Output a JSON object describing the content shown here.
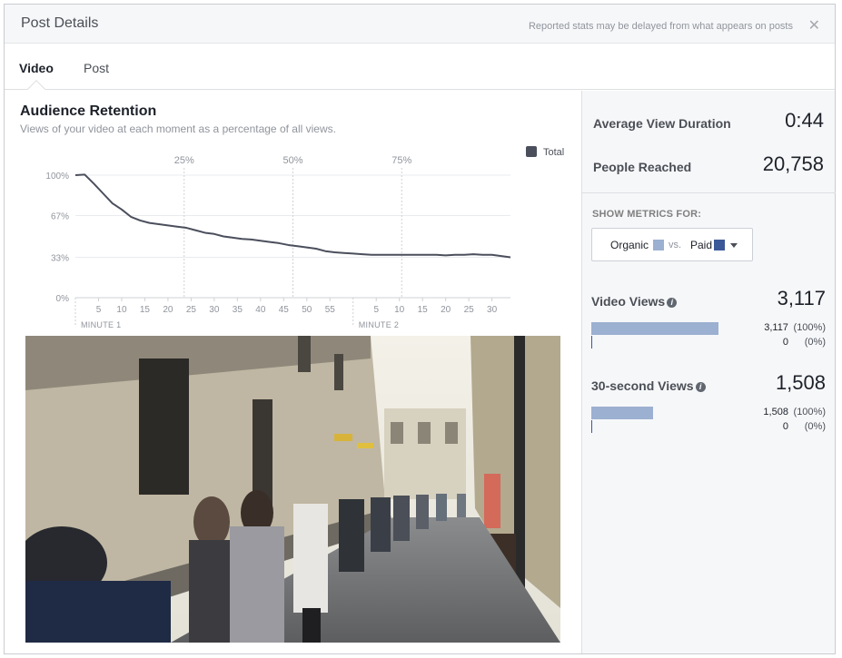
{
  "header": {
    "title": "Post Details",
    "note": "Reported stats may be delayed from what appears on posts",
    "close_glyph": "✕"
  },
  "tabs": [
    {
      "label": "Video",
      "active": true
    },
    {
      "label": "Post",
      "active": false
    }
  ],
  "retention": {
    "title": "Audience Retention",
    "subtitle": "Views of your video at each moment as a percentage of all views."
  },
  "chart_data": {
    "type": "line",
    "series": [
      {
        "name": "Total",
        "color": "#4b4f5c",
        "x": [
          0,
          2,
          4,
          6,
          8,
          10,
          12,
          14,
          16,
          18,
          20,
          22,
          24,
          26,
          28,
          30,
          32,
          34,
          36,
          38,
          40,
          42,
          44,
          46,
          48,
          50,
          52,
          54,
          56,
          58,
          60,
          62,
          64,
          66,
          68,
          70,
          72,
          74,
          76,
          78,
          80,
          82,
          84,
          86,
          88,
          90,
          92,
          94
        ],
        "values": [
          100,
          100.5,
          93,
          85,
          77,
          72,
          66,
          63,
          61,
          60,
          59,
          58,
          57,
          55,
          53,
          52,
          50,
          49,
          48,
          47.5,
          46.5,
          45.5,
          44.5,
          43,
          42,
          41,
          40,
          38,
          37,
          36.5,
          36,
          35.5,
          35,
          35,
          35,
          35,
          35,
          35,
          35,
          35,
          34.5,
          35,
          35,
          35.5,
          35,
          35,
          34,
          33
        ]
      }
    ],
    "y_ticks": [
      "100%",
      "67%",
      "33%",
      "0%"
    ],
    "y_tick_values": [
      100,
      67,
      33,
      0
    ],
    "ylim": [
      0,
      100
    ],
    "xlim": [
      0,
      94
    ],
    "quartiles": [
      {
        "label": "25%",
        "x": 23.5
      },
      {
        "label": "50%",
        "x": 47
      },
      {
        "label": "75%",
        "x": 70.5
      }
    ],
    "x_ticks": [
      {
        "x": 5,
        "label": "5"
      },
      {
        "x": 10,
        "label": "10"
      },
      {
        "x": 15,
        "label": "15"
      },
      {
        "x": 20,
        "label": "20"
      },
      {
        "x": 25,
        "label": "25"
      },
      {
        "x": 30,
        "label": "30"
      },
      {
        "x": 35,
        "label": "35"
      },
      {
        "x": 40,
        "label": "40"
      },
      {
        "x": 45,
        "label": "45"
      },
      {
        "x": 50,
        "label": "50"
      },
      {
        "x": 55,
        "label": "55"
      },
      {
        "x": 65,
        "label": "5"
      },
      {
        "x": 70,
        "label": "10"
      },
      {
        "x": 75,
        "label": "15"
      },
      {
        "x": 80,
        "label": "20"
      },
      {
        "x": 85,
        "label": "25"
      },
      {
        "x": 90,
        "label": "30"
      }
    ],
    "minute_markers": [
      {
        "x": 0,
        "label": "MINUTE 1"
      },
      {
        "x": 60,
        "label": "MINUTE 2"
      }
    ],
    "legend": {
      "label": "Total",
      "position": "top-right"
    },
    "grid": true
  },
  "stats": {
    "avg_view_label": "Average View Duration",
    "avg_view_value": "0:44",
    "reached_label": "People Reached",
    "reached_value": "20,758"
  },
  "metrics_filter": {
    "label": "SHOW METRICS FOR:",
    "organic": "Organic",
    "vs": "vs.",
    "paid": "Paid",
    "organic_color": "#9cb0d1",
    "paid_color": "#3b5998"
  },
  "video_views": {
    "label": "Video Views",
    "total": "3,117",
    "organic_value": "3,117",
    "organic_pct": "(100%)",
    "organic_fraction": 1.0,
    "paid_value": "0",
    "paid_pct": "(0%)",
    "paid_fraction": 0
  },
  "thirty_sec_views": {
    "label": "30-second Views",
    "total": "1,508",
    "organic_value": "1,508",
    "organic_pct": "(100%)",
    "organic_fraction": 0.484,
    "paid_value": "0",
    "paid_pct": "(0%)",
    "paid_fraction": 0
  }
}
